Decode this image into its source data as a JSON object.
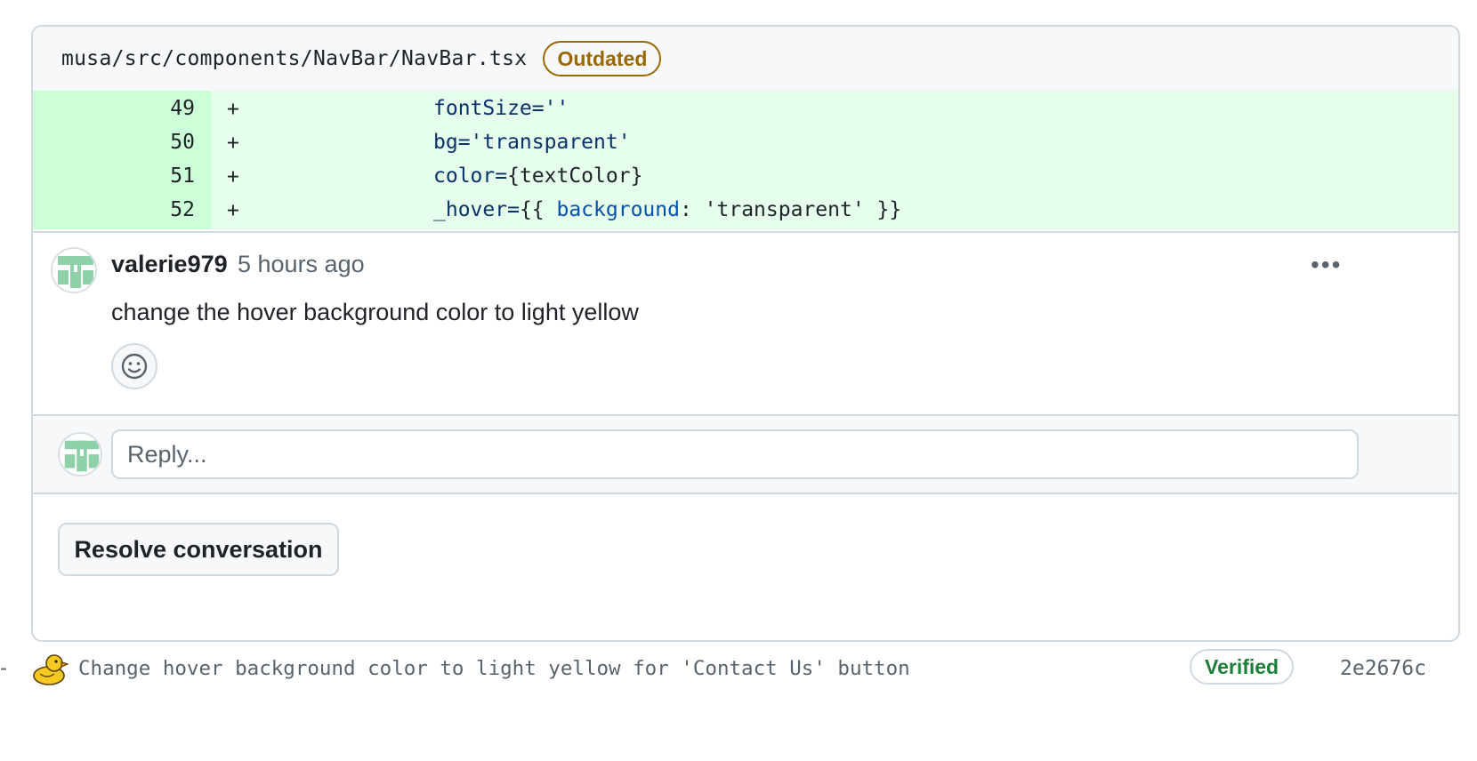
{
  "file": {
    "path": "musa/src/components/NavBar/NavBar.tsx",
    "status_badge": "Outdated"
  },
  "diff": {
    "lines": [
      {
        "number": "49",
        "sign": "+",
        "attr": "fontSize=",
        "rest": "''"
      },
      {
        "number": "50",
        "sign": "+",
        "attr": "bg=",
        "rest": "'transparent'"
      },
      {
        "number": "51",
        "sign": "+",
        "attr": "color=",
        "rest": "{textColor}"
      },
      {
        "number": "52",
        "sign": "+",
        "attr": "_hover=",
        "rest_a": "{{ ",
        "prop": "background",
        "rest_b": ": 'transparent' }}"
      }
    ]
  },
  "comment": {
    "author": "valerie979",
    "time": "5 hours ago",
    "body": "change the hover background color to light yellow",
    "menu_glyph": "•••"
  },
  "reply": {
    "placeholder": "Reply..."
  },
  "actions": {
    "resolve_label": "Resolve conversation"
  },
  "commit": {
    "prefix": "-",
    "message": "Change hover background color to light yellow for 'Contact Us' button",
    "verified_label": "Verified",
    "sha": "2e2676c"
  },
  "colors": {
    "added_bg": "#e6ffec",
    "added_num_bg": "#ccffd8",
    "outdated": "#9a6700",
    "verified": "#1a7f37",
    "avatar_green": "#8ed1a9"
  },
  "icons": {
    "avatar": "identicon-avatar",
    "menu": "kebab-horizontal-icon",
    "reaction": "smiley-icon",
    "commit_avatar": "duck-icon"
  }
}
